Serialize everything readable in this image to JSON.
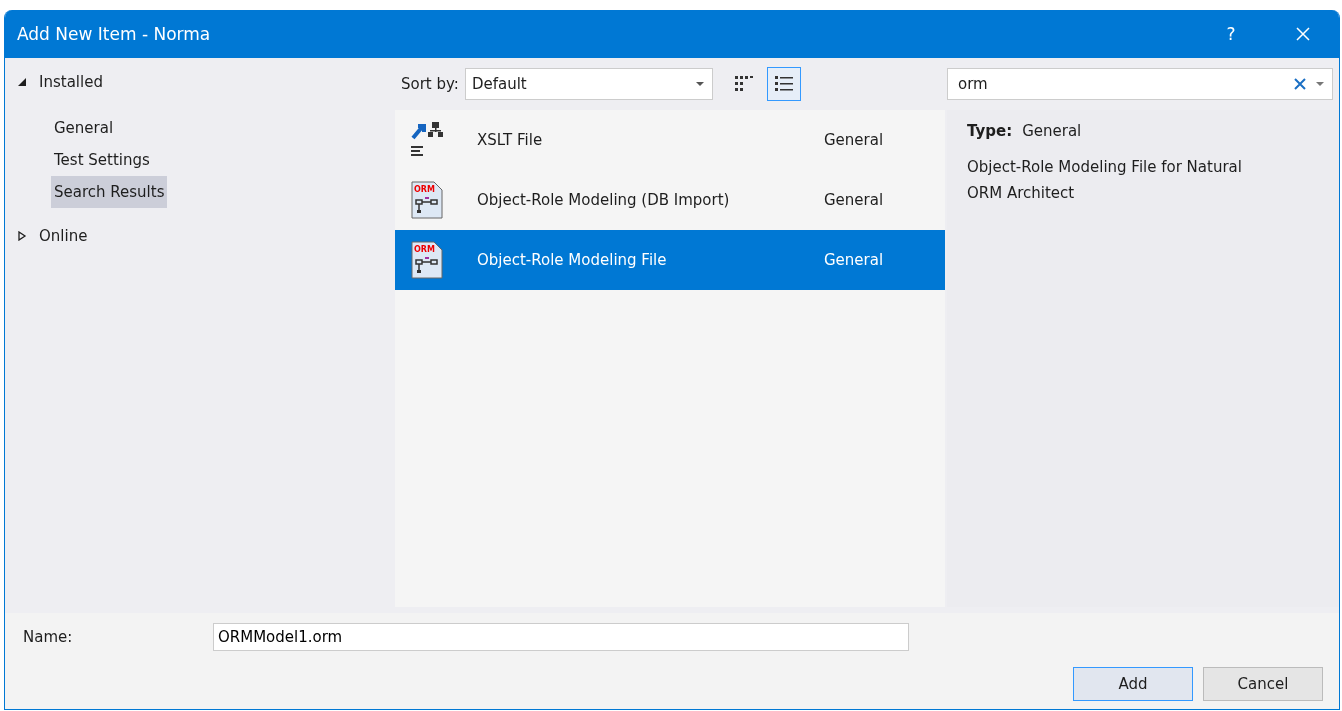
{
  "window": {
    "title": "Add New Item - Norma",
    "help": "?"
  },
  "tree": [
    {
      "label": "Installed",
      "expanded": true,
      "children": [
        {
          "label": "General",
          "selected": false
        },
        {
          "label": "Test Settings",
          "selected": false
        },
        {
          "label": "Search Results",
          "selected": true
        }
      ]
    },
    {
      "label": "Online",
      "expanded": false
    }
  ],
  "toolbar": {
    "sort_label": "Sort by:",
    "sort_value": "Default",
    "views": [
      {
        "kind": "grid",
        "selected": false
      },
      {
        "kind": "list",
        "selected": true
      }
    ]
  },
  "search": {
    "value": "orm"
  },
  "templates": [
    {
      "kind": "xslt",
      "name": "XSLT File",
      "category": "General",
      "selected": false
    },
    {
      "kind": "orm",
      "icon_text": "ORM",
      "name": "Object-Role Modeling (DB Import)",
      "category": "General",
      "selected": false
    },
    {
      "kind": "orm",
      "icon_text": "ORM",
      "name": "Object-Role Modeling File",
      "category": "General",
      "selected": true
    }
  ],
  "details": {
    "type_label": "Type:",
    "type_value": "General",
    "description": "Object-Role Modeling File for Natural ORM Architect"
  },
  "name_field": {
    "label": "Name:",
    "value": "ORMModel1.orm"
  },
  "buttons": [
    {
      "label": "Add",
      "default": true
    },
    {
      "label": "Cancel",
      "default": false
    }
  ]
}
